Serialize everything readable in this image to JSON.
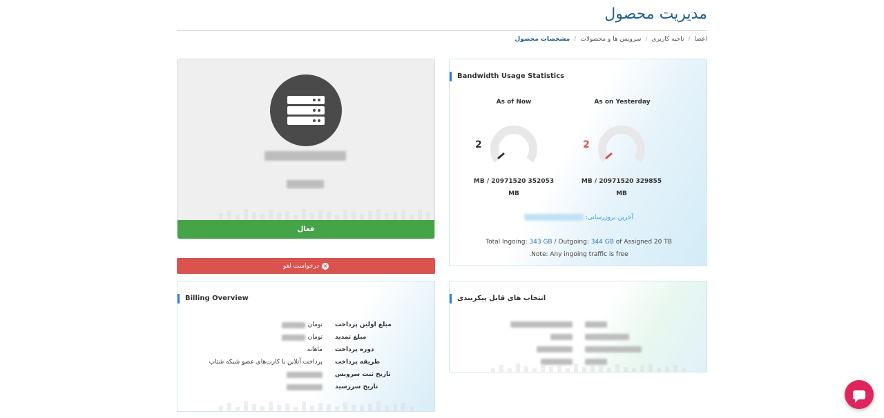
{
  "page": {
    "title": "مدیریت محصول"
  },
  "breadcrumb": [
    "اعضا",
    "ناحیه کاربری",
    "سرویس ها و محصولات",
    "مشخصات محصول"
  ],
  "product": {
    "status": "فعال",
    "cancel_label": "درخواست لغو"
  },
  "bandwidth": {
    "title": "Bandwidth Usage Statistics",
    "now": {
      "label": "As of Now",
      "value": "2",
      "usage": "MB / 20971520 352053",
      "unit": "MB"
    },
    "yesterday": {
      "label": "As on Yesterday",
      "value": "2",
      "usage": "MB / 20971520 329855",
      "unit": "MB"
    },
    "last_update_label": "آخرین بروزرسانی:",
    "total_prefix": "Total Ingoing:",
    "ingoing": "343 GB",
    "outgoing_prefix": "/ Outgoing:",
    "outgoing": "344 GB",
    "assigned": "of Assigned 20 TB",
    "note": ".Note: Any ingoing traffic is free",
    "colors": {
      "now_needle": "#333333",
      "yesterday_needle": "#d9534f",
      "yesterday_value": "#d9534f"
    }
  },
  "billing": {
    "title": "Billing Overview",
    "rows": [
      {
        "label": "مبلغ اولین پرداخت",
        "value": "تومان"
      },
      {
        "label": "مبلغ تمدید",
        "value": "تومان"
      },
      {
        "label": "دوره پرداخت",
        "value": "ماهانه"
      },
      {
        "label": "طریقه پرداخت",
        "value": "پرداخت آنلاین با کارت‌های عضو شبکه شتاب"
      },
      {
        "label": "تاریخ ثبت سرویس",
        "value": ""
      },
      {
        "label": "تاریخ سررسید",
        "value": ""
      }
    ]
  },
  "config": {
    "title": "انتخاب های قابل پیکربندی"
  },
  "icons": {
    "server": "server-icon",
    "cancel": "times-circle-icon",
    "chat": "chat-icon"
  }
}
